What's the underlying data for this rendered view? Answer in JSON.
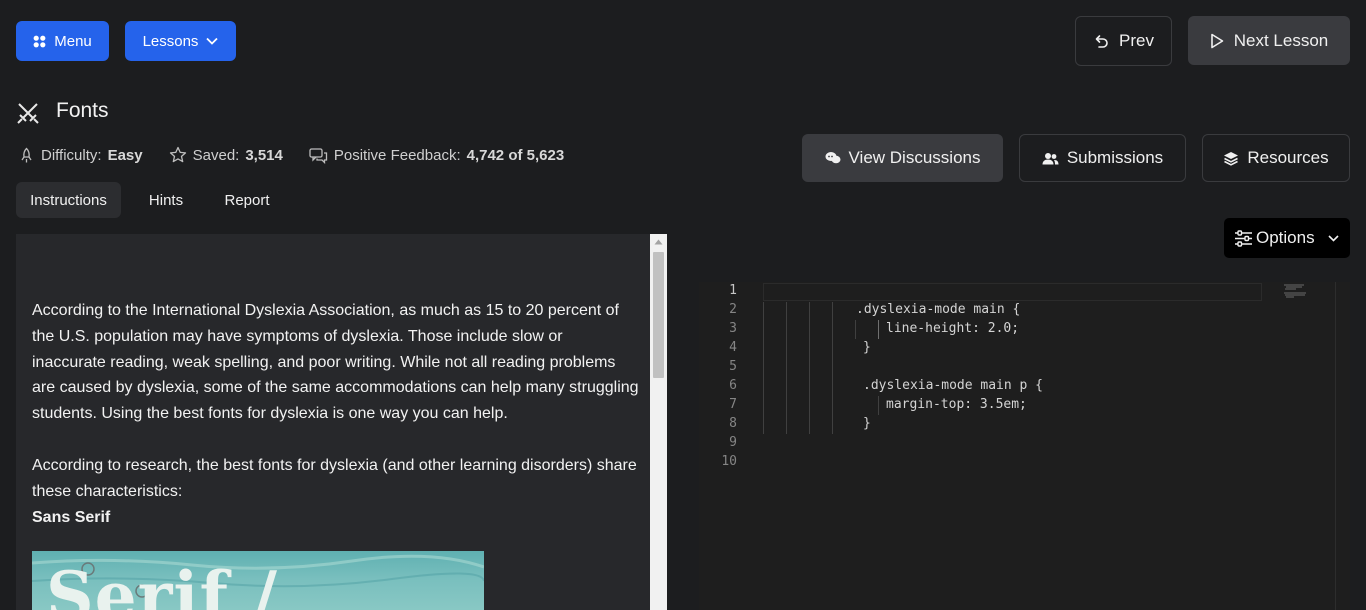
{
  "nav": {
    "menu_label": "Menu",
    "lessons_label": "Lessons",
    "prev_label": "Prev",
    "next_label": "Next Lesson"
  },
  "lesson": {
    "title": "Fonts",
    "difficulty_label": "Difficulty:",
    "difficulty_value": "Easy",
    "saved_label": "Saved:",
    "saved_value": "3,514",
    "feedback_label": "Positive Feedback:",
    "feedback_value": "4,742 of 5,623"
  },
  "actions": {
    "discussions_label": "View Discussions",
    "submissions_label": "Submissions",
    "resources_label": "Resources"
  },
  "tabs": [
    {
      "label": "Instructions",
      "active": true
    },
    {
      "label": "Hints"
    },
    {
      "label": "Report"
    }
  ],
  "instructions": {
    "paragraph1": "According to the International Dyslexia Association, as much as 15 to 20 percent of the U.S. population may have symptoms of dyslexia. Those include slow or inaccurate reading, weak spelling, and poor writing. While not all reading problems are caused by dyslexia, some of the same accommodations can help many struggling students. Using the best fonts for dyslexia is one way you can help.",
    "paragraph2": "According to research, the best fonts for dyslexia (and other learning disorders) share these characteristics:",
    "heading": "Sans Serif",
    "image_text": "Serif /"
  },
  "editor": {
    "options_label": "Options",
    "lines": [
      {
        "num": "1",
        "text": ""
      },
      {
        "num": "2",
        "text": ".dyslexia-mode main {"
      },
      {
        "num": "3",
        "text": "line-height: 2.0;"
      },
      {
        "num": "4",
        "text": "}"
      },
      {
        "num": "5",
        "text": ""
      },
      {
        "num": "6",
        "text": ".dyslexia-mode main p {"
      },
      {
        "num": "7",
        "text": "margin-top: 3.5em;"
      },
      {
        "num": "8",
        "text": "}"
      },
      {
        "num": "9",
        "text": ""
      },
      {
        "num": "10",
        "text": ""
      }
    ]
  },
  "colors": {
    "primary": "#2563eb",
    "background": "#1c1d1f",
    "panel": "#27282b",
    "editor_bg": "#1e1e1e"
  }
}
